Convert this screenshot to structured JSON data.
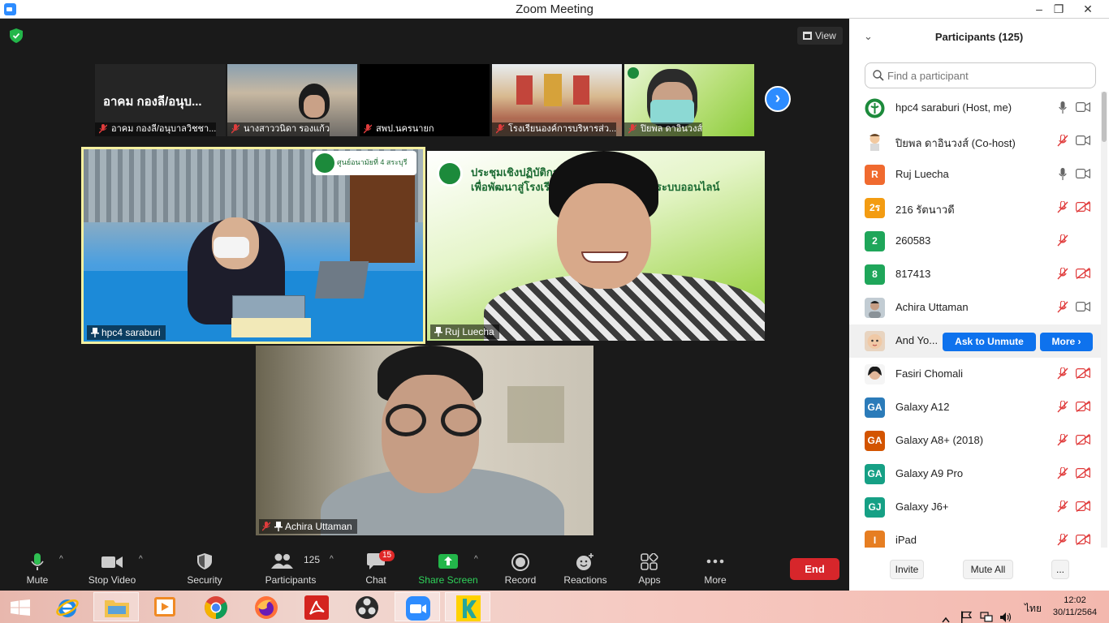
{
  "window": {
    "title": "Zoom Meeting",
    "min_glyph": "–",
    "max_glyph": "❐",
    "close_glyph": "✕"
  },
  "meeting": {
    "view_label": "View",
    "thumbnails": [
      {
        "name": "อาคม กองลี/อนุบาลวิชชา...",
        "big_name": "อาคม กองลี/อนุบ...",
        "muted": true
      },
      {
        "name": "นางสาววนิดา  รองแก้ว",
        "muted": true
      },
      {
        "name": "สพป.นครนายก",
        "muted": true
      },
      {
        "name": "โรงเรียนองค์การบริหารส่ว...",
        "muted": true
      },
      {
        "name": "ปิยพล ดาอินวงส์",
        "muted": true
      }
    ],
    "tiles": [
      {
        "name": "hpc4 saraburi",
        "pinned": true,
        "active_speaker": true
      },
      {
        "name": "Ruj Luecha",
        "pinned": true
      },
      {
        "name": "Achira Uttaman",
        "pinned": true,
        "muted": true
      }
    ],
    "banner_text_1": "ประชุมเชิงปฏิบัติการเครื",
    "banner_text_2": "เพื่อพัฒนาสู่โรงเรียนรอ",
    "banner_text_3": "ระบบออนไลน์",
    "logo_text": "ศูนย์อนามัยที่ 4 สระบุรี"
  },
  "toolbar": {
    "mute": "Mute",
    "stop_video": "Stop Video",
    "security": "Security",
    "participants": "Participants",
    "participants_count": "125",
    "chat": "Chat",
    "chat_badge": "15",
    "share_screen": "Share Screen",
    "record": "Record",
    "reactions": "Reactions",
    "apps": "Apps",
    "more": "More",
    "end": "End"
  },
  "panel": {
    "title": "Participants (125)",
    "search_placeholder": "Find a participant",
    "participants": [
      {
        "name": "hpc4 saraburi (Host, me)",
        "avatar_type": "logo",
        "mic": "on",
        "video": "on"
      },
      {
        "name": "ปิยพล ดาอินวงส์ (Co-host)",
        "avatar_type": "cartoon",
        "mic": "off",
        "video": "on"
      },
      {
        "name": "Ruj Luecha",
        "avatar_text": "R",
        "avatar_color": "#f06a2f",
        "mic": "on",
        "video": "on"
      },
      {
        "name": "216 รัตนาวดี",
        "avatar_text": "2ร",
        "avatar_color": "#f39c12",
        "mic": "off",
        "video": "off"
      },
      {
        "name": "260583",
        "avatar_text": "2",
        "avatar_color": "#1fa65a",
        "mic": "off",
        "video": "none"
      },
      {
        "name": "817413",
        "avatar_text": "8",
        "avatar_color": "#1fa65a",
        "mic": "off",
        "video": "off"
      },
      {
        "name": "Achira Uttaman",
        "avatar_type": "photo",
        "mic": "off",
        "video": "on"
      },
      {
        "name": "And Yo...",
        "avatar_type": "baby",
        "hover": true
      },
      {
        "name": "Fasiri Chomali",
        "avatar_type": "photo2",
        "mic": "off",
        "video": "off"
      },
      {
        "name": "Galaxy A12",
        "avatar_text": "GA",
        "avatar_color": "#2b7bb9",
        "mic": "off",
        "video": "off"
      },
      {
        "name": "Galaxy A8+ (2018)",
        "avatar_text": "GA",
        "avatar_color": "#d35400",
        "mic": "off",
        "video": "off"
      },
      {
        "name": "Galaxy A9 Pro",
        "avatar_text": "GA",
        "avatar_color": "#16a085",
        "mic": "off",
        "video": "off"
      },
      {
        "name": "Galaxy J6+",
        "avatar_text": "GJ",
        "avatar_color": "#16a085",
        "mic": "off",
        "video": "off"
      },
      {
        "name": "iPad",
        "avatar_text": "I",
        "avatar_color": "#e67e22",
        "mic": "off",
        "video": "off"
      }
    ],
    "ask_to_unmute": "Ask to Unmute",
    "more_label": "More ›",
    "invite": "Invite",
    "mute_all": "Mute All",
    "more_dots": "..."
  },
  "taskbar": {
    "items": [
      "start",
      "internet-explorer",
      "file-explorer",
      "media-player",
      "chrome",
      "firefox",
      "acrobat",
      "obs",
      "zoom",
      "kahoot"
    ],
    "language": "ไทย",
    "time": "12:02",
    "date": "30/11/2564"
  }
}
